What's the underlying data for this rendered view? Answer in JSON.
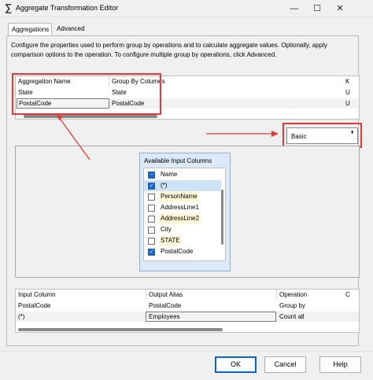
{
  "window": {
    "title": "Aggregate Transformation Editor",
    "title_icon": "∑",
    "minimize_glyph": "—",
    "maximize_glyph": "☐",
    "close_glyph": "✕"
  },
  "tabs": [
    {
      "label": "Aggregations",
      "active": true
    },
    {
      "label": "Advanced",
      "active": false
    }
  ],
  "description": "Configure the properties used to perform group by operations and to calculate aggregate values. Optionally, apply comparison options to the operation. To configure multiple group by operations, click Advanced.",
  "aggregation_grid": {
    "headers": [
      "Aggregation Name",
      "Group By Columes",
      "K"
    ],
    "rows": [
      [
        "State",
        "State",
        "U"
      ],
      [
        "PostalCode",
        "PostalCode",
        "U"
      ]
    ]
  },
  "mode_combo": {
    "value": "Basic",
    "arrow_glyph": "⬍"
  },
  "available_columns": {
    "title": "Available Input Columns",
    "items": [
      {
        "label": "Name",
        "state": "minus",
        "mark": "−"
      },
      {
        "label": "(*)",
        "state": "checked",
        "mark": "✓"
      },
      {
        "label": "PersonName",
        "state": "unchecked",
        "mark": ""
      },
      {
        "label": "AddressLine1",
        "state": "unchecked",
        "mark": ""
      },
      {
        "label": "AddressLine2",
        "state": "unchecked",
        "mark": ""
      },
      {
        "label": "City",
        "state": "unchecked",
        "mark": ""
      },
      {
        "label": "STATE",
        "state": "unchecked",
        "mark": ""
      },
      {
        "label": "PostalCode",
        "state": "checked",
        "mark": "✓"
      }
    ]
  },
  "operation_grid": {
    "headers": [
      "Input Column",
      "Output Alias",
      "Operation",
      "C"
    ],
    "rows": [
      [
        "PostalCode",
        "PostalCode",
        "Group by",
        ""
      ],
      [
        "(*)",
        "Employees",
        "Count all",
        ""
      ]
    ]
  },
  "buttons": {
    "ok": "OK",
    "cancel": "Cancel",
    "help": "Help"
  },
  "colors": {
    "annotation_red": "#e23a3a",
    "check_blue": "#1f63c3",
    "default_button_border": "#0a63d3"
  }
}
